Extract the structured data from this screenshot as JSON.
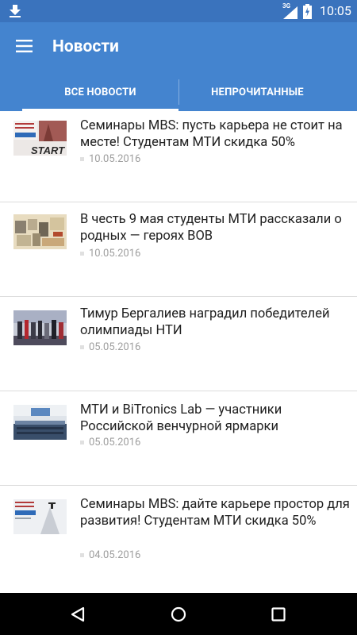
{
  "status_bar": {
    "time": "10:05",
    "network": "3G",
    "icons": [
      "download-icon",
      "signal-icon",
      "battery-charging-icon"
    ]
  },
  "app_bar": {
    "title": "Новости",
    "menu_icon": "hamburger-menu-icon"
  },
  "tabs": [
    {
      "label": "ВСЕ НОВОСТИ",
      "selected": true
    },
    {
      "label": "НЕПРОЧИТАННЫЕ",
      "selected": false
    }
  ],
  "news": [
    {
      "title": "Семинары MBS: пусть карьера не стоит на месте! Студентам МТИ скидка 50%",
      "date": "10.05.2016",
      "image": "seminar-start-banner"
    },
    {
      "title": "В честь 9 мая студенты МТИ рассказали о родных — героях ВОВ",
      "date": "10.05.2016",
      "image": "war-heroes-collage"
    },
    {
      "title": "Тимур Бергалиев наградил победителей олимпиады НТИ",
      "date": "05.05.2016",
      "image": "award-ceremony-photo"
    },
    {
      "title": "МТИ и BiTronics Lab — участники Российской венчурной ярмарки",
      "date": "05.05.2016",
      "image": "venture-fair-hall-photo"
    },
    {
      "title": "Семинары MBS: дайте карьере простор для развития! Студентам МТИ скидка 50%",
      "date": "04.05.2016",
      "image": "seminar-ladder-banner"
    }
  ],
  "nav_bar": {
    "buttons": [
      "back-icon",
      "home-icon",
      "recents-icon"
    ]
  },
  "colors": {
    "primary": "#4484cf",
    "primary_dark": "#3a73bd",
    "text": "#212121",
    "date_text": "#9e9e9e"
  }
}
